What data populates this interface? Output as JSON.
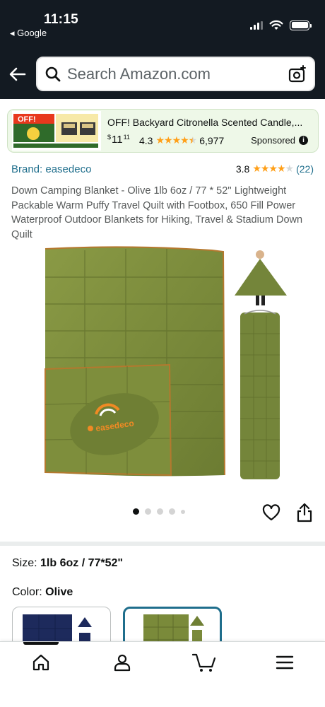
{
  "status_bar": {
    "time": "11:15",
    "back_app": "Google"
  },
  "search": {
    "placeholder": "Search Amazon.com"
  },
  "sponsored_ad": {
    "title": "OFF! Backyard Citronella Scented Candle,...",
    "price_symbol": "$",
    "price_whole": "11",
    "price_fraction": "11",
    "rating": "4.3",
    "rating_stars": 4.5,
    "review_count": "6,977",
    "label": "Sponsored"
  },
  "product": {
    "brand": "Brand: easedeco",
    "rating": "3.8",
    "rating_stars": 4,
    "review_count": "(22)",
    "title": "Down Camping Blanket - Olive 1lb 6oz / 77 * 52'' Lightweight Packable Warm Puffy Travel Quilt with Footbox, 650 Fill Power Waterproof Outdoor Blankets for Hiking, Travel & Stadium Down Quilt",
    "image_logo_text": "easedeco",
    "carousel_total": 5,
    "carousel_active": 1
  },
  "options": {
    "size_label": "Size:",
    "size_value": "1lb 6oz / 77*52\"",
    "color_label": "Color:",
    "color_value": "Olive",
    "swatches": [
      "navy",
      "olive"
    ],
    "selected_swatch": "olive"
  },
  "bottom_nav": {
    "items": [
      "home-icon",
      "account-icon",
      "cart-icon",
      "menu-icon"
    ],
    "active": "home-icon"
  },
  "colors": {
    "header_bg": "#131a22",
    "link": "#1f6e8c",
    "star": "#ff9f17",
    "olive": "#7a8a3a",
    "navy": "#1d2a5c"
  }
}
